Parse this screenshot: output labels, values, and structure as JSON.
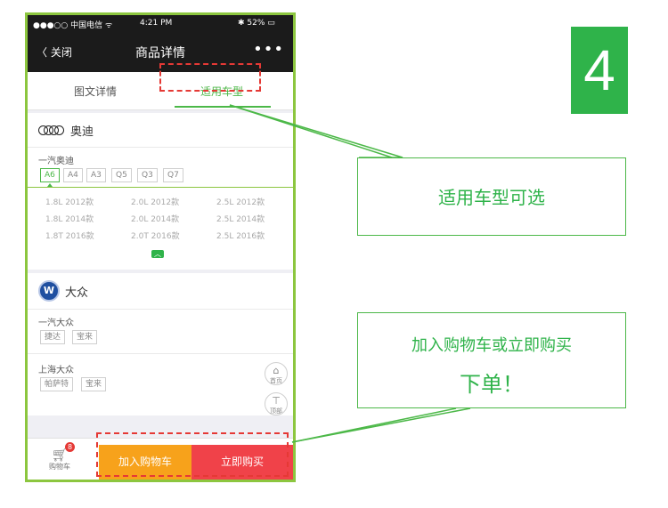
{
  "status_bar": {
    "carrier": "●●●○○ 中国电信 ᯤ",
    "time": "4:21 PM",
    "battery": "✱ 52% ▭"
  },
  "nav": {
    "back": "〈 关闭",
    "title": "商品详情",
    "more": "•••"
  },
  "tabs": [
    {
      "label": "图文详情"
    },
    {
      "label": "适用车型",
      "active": true
    }
  ],
  "brands": [
    {
      "name": "奥迪",
      "groups": [
        {
          "label": "一汽奥迪",
          "models": [
            "A6",
            "A4",
            "A3",
            "Q5",
            "Q3",
            "Q7"
          ],
          "selected_model": "A6",
          "variants": [
            [
              "1.8L 2012款",
              "2.0L 2012款",
              "2.5L 2012款"
            ],
            [
              "1.8L 2014款",
              "2.0L 2014款",
              "2.5L 2014款"
            ],
            [
              "1.8T 2016款",
              "2.0T 2016款",
              "2.5L 2016款"
            ]
          ]
        }
      ]
    },
    {
      "name": "大众",
      "groups": [
        {
          "label": "一汽大众",
          "models": [
            "捷达",
            "宝来"
          ]
        },
        {
          "label": "上海大众",
          "models": [
            "帕萨特",
            "宝来"
          ]
        }
      ]
    }
  ],
  "float_buttons": [
    {
      "icon": "⌂",
      "label": "首页"
    },
    {
      "icon": "⊤",
      "label": "顶部"
    }
  ],
  "bottom_bar": {
    "cart_label": "购物车",
    "cart_badge": "8",
    "add_to_cart": "加入购物车",
    "buy_now": "立即购买"
  },
  "annotations": {
    "step_number": "4",
    "callout1": "适用车型可选",
    "callout2_line1": "加入购物车或立即购买",
    "callout2_line2": "下单！"
  },
  "colors": {
    "accent_green": "#2fb34a",
    "frame_green": "#8cc63f",
    "highlight_red": "#e53935",
    "add_cart_orange": "#f7a21b",
    "buy_red": "#f04249"
  }
}
